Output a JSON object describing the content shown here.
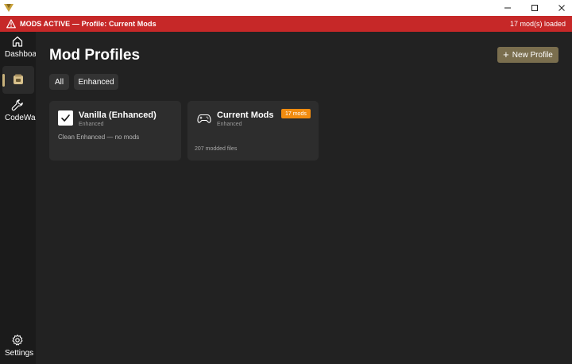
{
  "window": {
    "logo_icon": "v-logo-icon",
    "controls": [
      "minimize-icon",
      "maximize-icon",
      "close-icon"
    ]
  },
  "banner": {
    "icon": "warning-icon",
    "text": "MODS ACTIVE — Profile: Current Mods",
    "count": "17 mod(s) loaded",
    "color": "#c62828"
  },
  "sidebar": {
    "items": [
      {
        "label": "Dashboard",
        "icon": "home-icon"
      },
      {
        "label": "",
        "icon": "profiles-icon",
        "active": true
      },
      {
        "label": "CodeWalker",
        "icon": "wrench-icon"
      }
    ],
    "settings": {
      "label": "Settings",
      "icon": "gear-icon"
    }
  },
  "main": {
    "title": "Mod Profiles",
    "new_profile_label": "New Profile",
    "filters": [
      "All",
      "Enhanced"
    ],
    "cards": [
      {
        "title": "Vanilla (Enhanced)",
        "subtitle": "Enhanced",
        "description": "Clean Enhanced — no mods",
        "icon": "check-icon"
      },
      {
        "title": "Current Mods",
        "subtitle": "Enhanced",
        "badge": "17 mods",
        "description": "207 modded files",
        "icon": "gamepad-icon"
      }
    ]
  },
  "colors": {
    "accent": "#c9b27c",
    "button": "#7a6e4e",
    "badge": "#f28c0f",
    "background": "#222222",
    "sidebar": "#1b1b1b",
    "card": "#2d2d2d"
  }
}
